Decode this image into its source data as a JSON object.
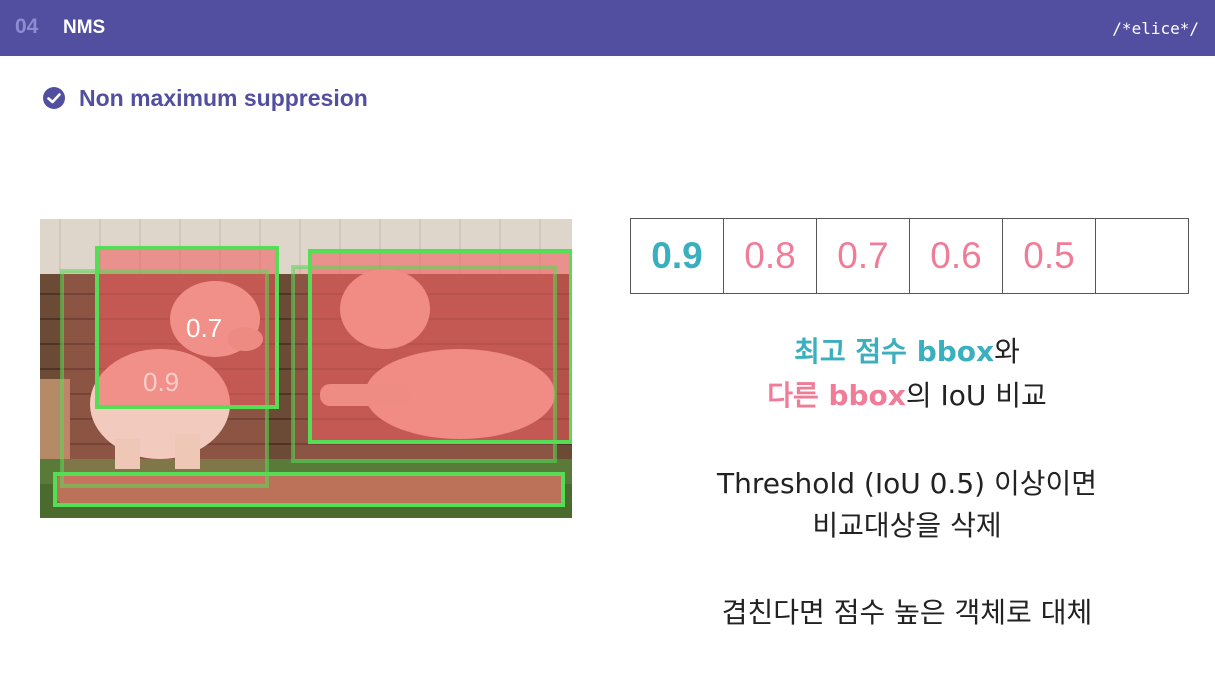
{
  "header": {
    "section_number": "04",
    "section_title": "NMS",
    "brand": "/*elice*/"
  },
  "subtitle": {
    "icon": "check-circle-icon",
    "text": "Non maximum suppresion"
  },
  "image": {
    "box_labels": [
      "0.7",
      "0.9"
    ]
  },
  "score_table": {
    "values": [
      "0.9",
      "0.8",
      "0.7",
      "0.6",
      "0.5",
      ""
    ]
  },
  "explanation": {
    "line1_highlight": "최고 점수 bbox",
    "line1_rest": "와",
    "line2_highlight": "다른 bbox",
    "line2_rest": "의 IoU 비교",
    "line3": "Threshold (IoU 0.5) 이상이면",
    "line4": "비교대상을 삭제",
    "line5": "겹친다면 점수 높은 객체로 대체"
  },
  "colors": {
    "header_bg": "#524fa1",
    "accent_purple": "#524fa1",
    "teal": "#3aafc0",
    "pink": "#f07c98",
    "box_green": "#55dd55",
    "box_fill_red": "#f05a5a"
  }
}
